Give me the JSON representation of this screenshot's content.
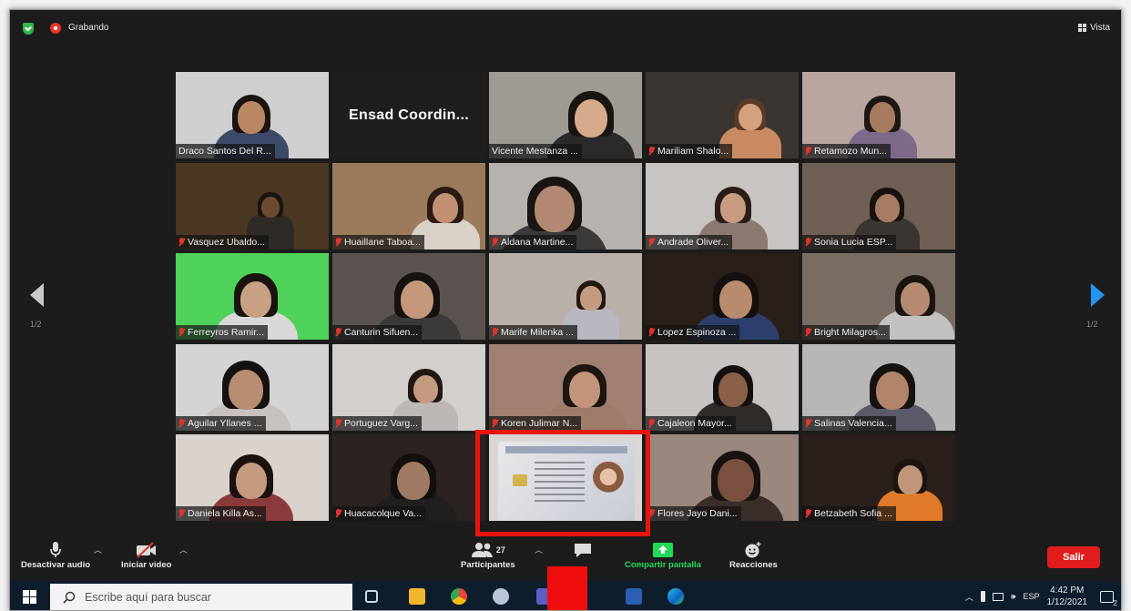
{
  "topbar": {
    "recording_label": "Grabando",
    "view_label": "Vista"
  },
  "pagination": {
    "left": "1/2",
    "right": "1/2"
  },
  "tiles": [
    {
      "name": "Draco Santos Del R...",
      "muted": false,
      "wall": "#cfcfd2",
      "skin": "#b98863",
      "hair": "#1c1410",
      "shirt": "#3b4a66",
      "hx": 52,
      "hs": 34
    },
    {
      "name": "",
      "text": "Ensad    Coordin...",
      "muted": false
    },
    {
      "name": "Vicente Mestanza ...",
      "muted": false,
      "active": true,
      "wall": "#9e9a94",
      "skin": "#d6aa8b",
      "hair": "#1a1412",
      "shirt": "#2a2a2a",
      "hx": 70,
      "hs": 40
    },
    {
      "name": "Mariliam Shalo...",
      "muted": true,
      "wall": "#3a3531",
      "skin": "#d3a27d",
      "hair": "#5a3a28",
      "shirt": "#c98a63",
      "hx": 72,
      "hs": 28
    },
    {
      "name": "Retamozo Mun...",
      "muted": true,
      "wall": "#b9a6a0",
      "skin": "#a87b60",
      "hair": "#1d1715",
      "shirt": "#7d6a8a",
      "hx": 55,
      "hs": 32
    },
    {
      "name": "Vasquez Ubaldo...",
      "muted": true,
      "wall": "#4a3823",
      "skin": "#6b4a30",
      "hair": "#1a1410",
      "shirt": "#2e2a26",
      "hx": 65,
      "hs": 22
    },
    {
      "name": "Huaillane Taboa...",
      "muted": true,
      "wall": "#9c7b5c",
      "skin": "#c49073",
      "hair": "#2a1b15",
      "shirt": "#d9d0c7",
      "hx": 78,
      "hs": 32
    },
    {
      "name": "Aldana Martine...",
      "muted": true,
      "wall": "#b7b2ae",
      "skin": "#b28a73",
      "hair": "#1a1412",
      "shirt": "#3a3a3a",
      "hx": 45,
      "hs": 48
    },
    {
      "name": "Andrade Oliver...",
      "muted": true,
      "wall": "#c8c4c2",
      "skin": "#c99b80",
      "hair": "#2a1d17",
      "shirt": "#8b7a70",
      "hx": 60,
      "hs": 32
    },
    {
      "name": "Sonia Lucia ESP...",
      "muted": true,
      "wall": "#6f5f54",
      "skin": "#a87c63",
      "hair": "#181310",
      "shirt": "#3b3532",
      "hx": 58,
      "hs": 30
    },
    {
      "name": "Ferreyros Ramir...",
      "muted": true,
      "wall": "#4fd25a",
      "skin": "#c9a084",
      "hair": "#1a1410",
      "shirt": "#d8d8d8",
      "hx": 55,
      "hs": 38
    },
    {
      "name": "Canturin Sifuen...",
      "muted": true,
      "wall": "#5a534f",
      "skin": "#c5987c",
      "hair": "#161210",
      "shirt": "#3a3a3a",
      "hx": 58,
      "hs": 40
    },
    {
      "name": "Marife Milenka ...",
      "muted": true,
      "wall": "#b9b0aa",
      "skin": "#c49a80",
      "hair": "#231712",
      "shirt": "#b8b8c0",
      "hx": 70,
      "hs": 26
    },
    {
      "name": "Lopez Espinoza ...",
      "muted": true,
      "wall": "#2a1e18",
      "skin": "#b98b6d",
      "hair": "#141010",
      "shirt": "#2c3e6b",
      "hx": 62,
      "hs": 40
    },
    {
      "name": "Bright Milagros...",
      "muted": true,
      "wall": "#7a6d63",
      "skin": "#b78b71",
      "hair": "#1b1512",
      "shirt": "#c2c2c2",
      "hx": 78,
      "hs": 36
    },
    {
      "name": "Aguilar Yllanes ...",
      "muted": true,
      "wall": "#d5d3d3",
      "skin": "#b88d72",
      "hair": "#151112",
      "shirt": "#c8c2bf",
      "hx": 48,
      "hs": 42
    },
    {
      "name": "Portuguez Varg...",
      "muted": true,
      "wall": "#d3cfcc",
      "skin": "#c29a80",
      "hair": "#201714",
      "shirt": "#bdb8b6",
      "hx": 64,
      "hs": 30
    },
    {
      "name": "Koren Julimar N...",
      "muted": true,
      "wall": "#a08070",
      "skin": "#c39479",
      "hair": "#1d1512",
      "shirt": "#9e7c6a",
      "hx": 66,
      "hs": 38
    },
    {
      "name": "Cajaleon Mayor...",
      "muted": true,
      "wall": "#c7c3c1",
      "skin": "#8a6049",
      "hair": "#151010",
      "shirt": "#2e2b29",
      "hx": 60,
      "hs": 36
    },
    {
      "name": "Salinas Valencia...",
      "muted": true,
      "wall": "#b9b7b6",
      "skin": "#b28469",
      "hair": "#161212",
      "shirt": "#5a5a6a",
      "hx": 62,
      "hs": 40
    },
    {
      "name": "Daniela Killa As...",
      "muted": true,
      "wall": "#d9d2cd",
      "skin": "#c69a7f",
      "hair": "#1a120f",
      "shirt": "#8a3a3a",
      "hx": 52,
      "hs": 38
    },
    {
      "name": "Huacacolque Va...",
      "muted": true,
      "wall": "#2b2320",
      "skin": "#a07a62",
      "hair": "#130f0e",
      "shirt": "#1f1f1f",
      "hx": 56,
      "hs": 40
    },
    {
      "name": "",
      "idcard": true,
      "muted": false
    },
    {
      "name": "Flores Jayo Dani...",
      "muted": true,
      "wall": "#9a877e",
      "skin": "#7a5040",
      "hair": "#191210",
      "shirt": "#3a2e2a",
      "hx": 62,
      "hs": 44
    },
    {
      "name": "Betzabeth Sofia ...",
      "muted": true,
      "wall": "#2a1f1b",
      "skin": "#c39579",
      "hair": "#1b1412",
      "shirt": "#e17a2a",
      "hx": 74,
      "hs": 30
    }
  ],
  "idcard_text": {
    "header": "REPUBLICA DEL PERU",
    "doc": "DNI"
  },
  "toolbar": {
    "audio": "Desactivar audio",
    "video": "Iniciar video",
    "participants": "Participantes",
    "participants_count": "27",
    "chat": "Chat",
    "share": "Compartir pantalla",
    "reactions": "Reacciones",
    "leave": "Salir"
  },
  "taskbar": {
    "search_placeholder": "Escribe aquí para buscar",
    "lang": "ESP",
    "time": "4:42 PM",
    "date": "1/12/2021",
    "notifications": "2"
  },
  "colors": {
    "active_speaker": "#c4e05a",
    "leave": "#e11c1c",
    "share": "#23d959",
    "highlight": "#e8150f"
  }
}
